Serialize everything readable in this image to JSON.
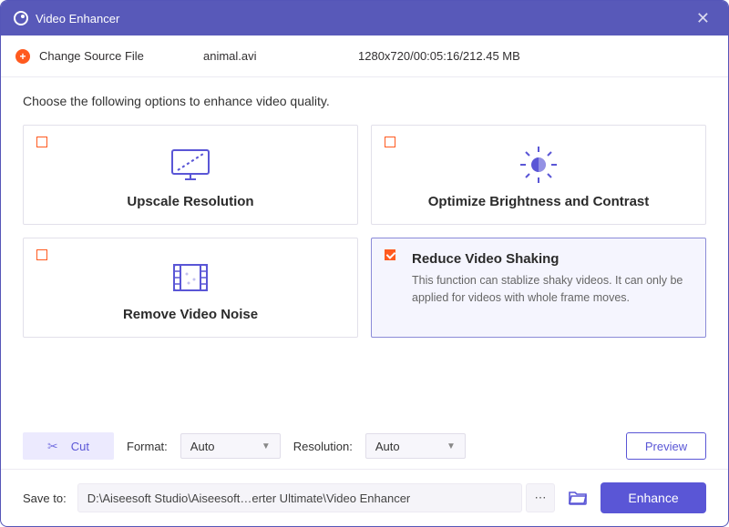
{
  "titlebar": {
    "title": "Video Enhancer"
  },
  "source": {
    "change_label": "Change Source File",
    "filename": "animal.avi",
    "metadata": "1280x720/00:05:16/212.45 MB"
  },
  "instruction": "Choose the following options to enhance video quality.",
  "cards": {
    "upscale": {
      "title": "Upscale Resolution"
    },
    "brightness": {
      "title": "Optimize Brightness and Contrast"
    },
    "noise": {
      "title": "Remove Video Noise"
    },
    "shaking": {
      "title": "Reduce Video Shaking",
      "desc": "This function can stablize shaky videos. It can only be applied for videos with whole frame moves."
    }
  },
  "controls": {
    "cut_label": "Cut",
    "format_label": "Format:",
    "format_value": "Auto",
    "resolution_label": "Resolution:",
    "resolution_value": "Auto",
    "preview_label": "Preview"
  },
  "footer": {
    "save_label": "Save to:",
    "path": "D:\\Aiseesoft Studio\\Aiseesoft…erter Ultimate\\Video Enhancer",
    "enhance_label": "Enhance"
  }
}
